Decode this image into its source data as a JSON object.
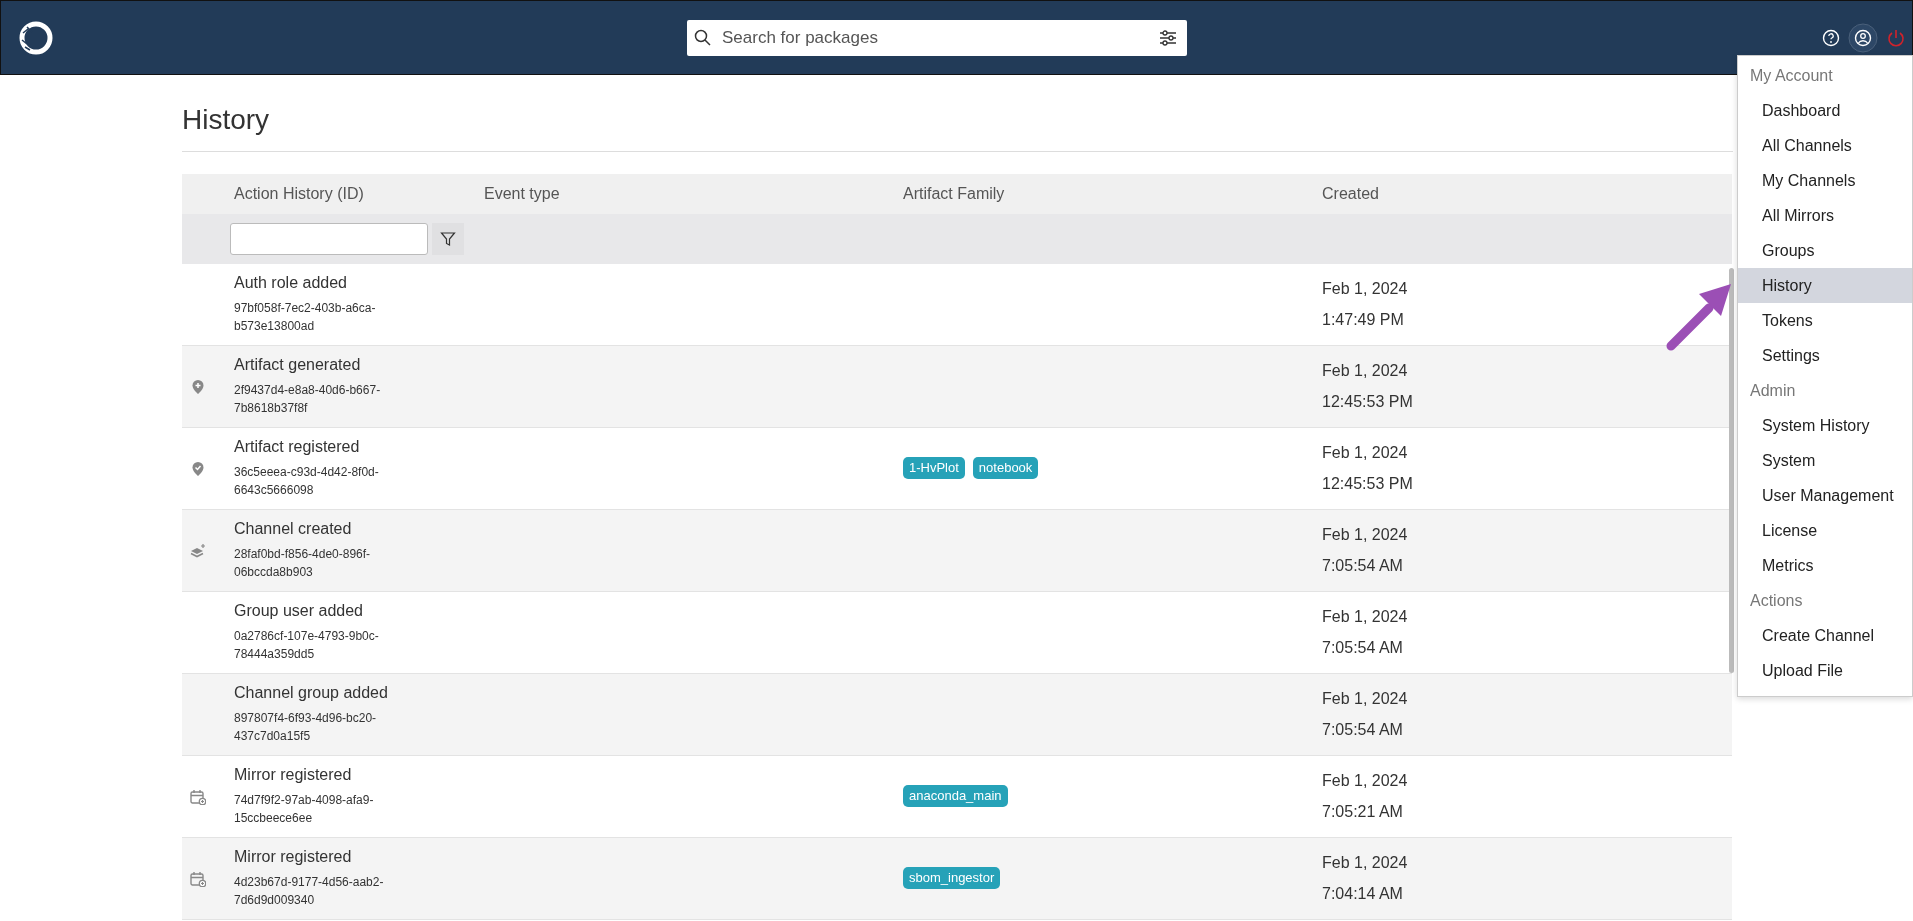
{
  "search": {
    "placeholder": "Search for packages"
  },
  "page_title": "History",
  "table": {
    "columns": [
      "Action History (ID)",
      "Event type",
      "Artifact Family",
      "Created"
    ],
    "rows": [
      {
        "kind": "plain",
        "action": "Auth role added",
        "id": "97bf058f-7ec2-403b-a6ca-b573e13800ad",
        "tags": [],
        "date": "Feb 1, 2024",
        "time": "1:47:49 PM"
      },
      {
        "kind": "generate",
        "action": "Artifact generated",
        "id": "2f9437d4-e8a8-40d6-b667-7b8618b37f8f",
        "tags": [],
        "date": "Feb 1, 2024",
        "time": "12:45:53 PM"
      },
      {
        "kind": "register",
        "action": "Artifact registered",
        "id": "36c5eeea-c93d-4d42-8f0d-6643c5666098",
        "tags": [
          "1-HvPlot",
          "notebook"
        ],
        "date": "Feb 1, 2024",
        "time": "12:45:53 PM"
      },
      {
        "kind": "channel",
        "action": "Channel created",
        "id": "28faf0bd-f856-4de0-896f-06bccda8b903",
        "tags": [],
        "date": "Feb 1, 2024",
        "time": "7:05:54 AM"
      },
      {
        "kind": "plain",
        "action": "Group user added",
        "id": "0a2786cf-107e-4793-9b0c-78444a359dd5",
        "tags": [],
        "date": "Feb 1, 2024",
        "time": "7:05:54 AM"
      },
      {
        "kind": "plain",
        "action": "Channel group added",
        "id": "897807f4-6f93-4d96-bc20-437c7d0a15f5",
        "tags": [],
        "date": "Feb 1, 2024",
        "time": "7:05:54 AM"
      },
      {
        "kind": "mirror",
        "action": "Mirror registered",
        "id": "74d7f9f2-97ab-4098-afa9-15ccbeece6ee",
        "tags": [
          "anaconda_main"
        ],
        "date": "Feb 1, 2024",
        "time": "7:05:21 AM"
      },
      {
        "kind": "mirror",
        "action": "Mirror registered",
        "id": "4d23b67d-9177-4d56-aab2-7d6d9d009340",
        "tags": [
          "sbom_ingestor"
        ],
        "date": "Feb 1, 2024",
        "time": "7:04:14 AM"
      }
    ]
  },
  "account_menu": {
    "sections": [
      {
        "header": "My Account",
        "items": [
          {
            "label": "Dashboard",
            "selected": false
          },
          {
            "label": "All Channels",
            "selected": false
          },
          {
            "label": "My Channels",
            "selected": false
          },
          {
            "label": "All Mirrors",
            "selected": false
          },
          {
            "label": "Groups",
            "selected": false
          },
          {
            "label": "History",
            "selected": true
          },
          {
            "label": "Tokens",
            "selected": false
          },
          {
            "label": "Settings",
            "selected": false
          }
        ]
      },
      {
        "header": "Admin",
        "items": [
          {
            "label": "System History",
            "selected": false
          },
          {
            "label": "System",
            "selected": false
          },
          {
            "label": "User Management",
            "selected": false
          },
          {
            "label": "License",
            "selected": false
          },
          {
            "label": "Metrics",
            "selected": false
          }
        ]
      },
      {
        "header": "Actions",
        "items": [
          {
            "label": "Create Channel",
            "selected": false
          },
          {
            "label": "Upload File",
            "selected": false
          }
        ]
      }
    ]
  }
}
